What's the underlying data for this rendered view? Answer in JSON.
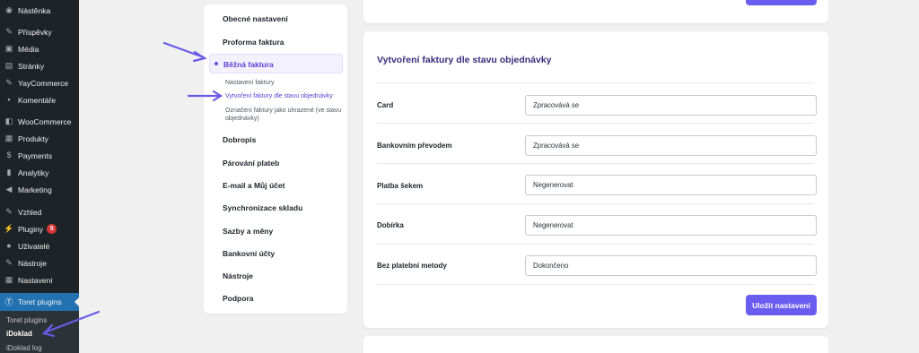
{
  "sidebar": {
    "items": [
      {
        "label": "Nástěnka",
        "icon": "dashboard-icon",
        "glyph": "◉"
      },
      {
        "label": "Příspěvky",
        "icon": "pin-icon",
        "glyph": "✎"
      },
      {
        "label": "Média",
        "icon": "media-icon",
        "glyph": "▣"
      },
      {
        "label": "Stránky",
        "icon": "pages-icon",
        "glyph": "▤"
      },
      {
        "label": "YayCommerce",
        "icon": "yaycommerce-icon",
        "glyph": "✎"
      },
      {
        "label": "Komentáře",
        "icon": "comments-icon",
        "glyph": "▪"
      },
      {
        "label": "WooCommerce",
        "icon": "woocommerce-icon",
        "glyph": "◧"
      },
      {
        "label": "Produkty",
        "icon": "products-icon",
        "glyph": "▦"
      },
      {
        "label": "Payments",
        "icon": "payments-icon",
        "glyph": "$"
      },
      {
        "label": "Analytiky",
        "icon": "analytics-icon",
        "glyph": "▮"
      },
      {
        "label": "Marketing",
        "icon": "marketing-icon",
        "glyph": "◀"
      },
      {
        "label": "Vzhled",
        "icon": "appearance-icon",
        "glyph": "✎"
      },
      {
        "label": "Pluginy",
        "icon": "plugins-icon",
        "glyph": "⚡",
        "badge": "5"
      },
      {
        "label": "Uživatelé",
        "icon": "users-icon",
        "glyph": "●"
      },
      {
        "label": "Nástroje",
        "icon": "tools-icon",
        "glyph": "✎"
      },
      {
        "label": "Nastavení",
        "icon": "settings-icon",
        "glyph": "▦"
      },
      {
        "label": "Toret plugins",
        "icon": "toret-icon",
        "glyph": "Ⓣ"
      }
    ],
    "submenu": [
      "Toret plugins",
      "iDoklad",
      "iDoklad log"
    ]
  },
  "nav": {
    "items": [
      "Obecné nastavení",
      "Proforma faktura",
      "Běžná faktura",
      "Dobropis",
      "Párování plateb",
      "E-mail a Můj účet",
      "Synchronizace skladu",
      "Sazby a měny",
      "Bankovní účty",
      "Nástroje",
      "Podpora"
    ],
    "subitems": [
      "Nastavení faktury",
      "Vytvoření faktury dle stavu objednávky",
      "Označení faktury jako uhrazené (ve stavu",
      "objednávky)"
    ]
  },
  "main": {
    "title": "Vytvoření faktury dle stavu objednávky",
    "rows": [
      {
        "label": "Card",
        "value": "Zpracovává se"
      },
      {
        "label": "Bankovním převodem",
        "value": "Zpracovává se"
      },
      {
        "label": "Platba šekem",
        "value": "Negenerovat"
      },
      {
        "label": "Dobírka",
        "value": "Negenerovat"
      },
      {
        "label": "Bez platební metody",
        "value": "Dokončeno"
      }
    ],
    "save_label": "Uložit nastavení"
  },
  "colors": {
    "accent": "#6b5cf0",
    "sidebar": "#1d2327",
    "active_menu": "#2271b1",
    "annotation_arrow": "#6a5ae8"
  }
}
